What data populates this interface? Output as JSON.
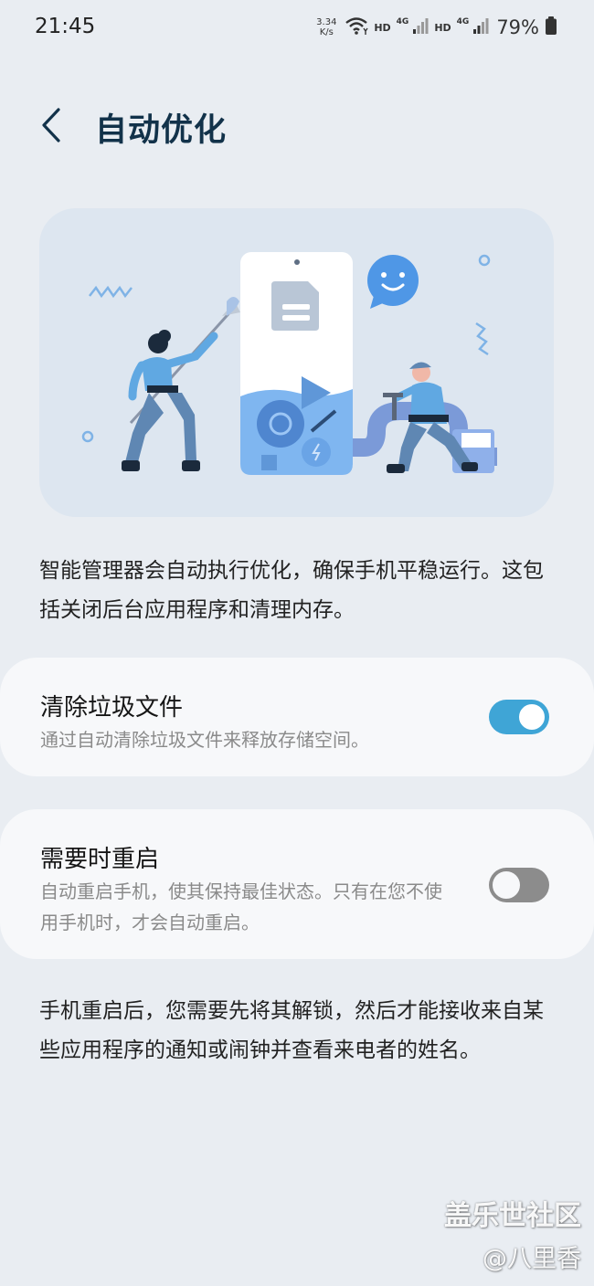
{
  "status_bar": {
    "time": "21:45",
    "net_speed_value": "3.34",
    "net_speed_unit": "K/s",
    "hd_1": "HD",
    "hd_2": "HD",
    "sim1_type": "4G",
    "sim2_type": "4G",
    "battery": "79%"
  },
  "header": {
    "title": "自动优化"
  },
  "description": "智能管理器会自动执行优化，确保手机平稳运行。这包括关闭后台应用程序和清理内存。",
  "settings": [
    {
      "title": "清除垃圾文件",
      "subtitle": "通过自动清除垃圾文件来释放存储空间。",
      "enabled": true
    },
    {
      "title": "需要时重启",
      "subtitle": "自动重启手机，使其保持最佳状态。只有在您不使用手机时，才会自动重启。",
      "enabled": false
    }
  ],
  "footer_note": "手机重启后，您需要先将其解锁，然后才能接收来自某些应用程序的通知或闹钟并查看来电者的姓名。",
  "watermark": {
    "line1": "盖乐世社区",
    "line2": "@八里香"
  },
  "colors": {
    "accent": "#3fa5d6",
    "title": "#12324a",
    "background": "#e9edf2",
    "card": "#f7f8fa",
    "subtitle": "#8a8a8a"
  },
  "icons": [
    "back-icon",
    "wifi-icon",
    "signal-icon",
    "battery-icon"
  ]
}
